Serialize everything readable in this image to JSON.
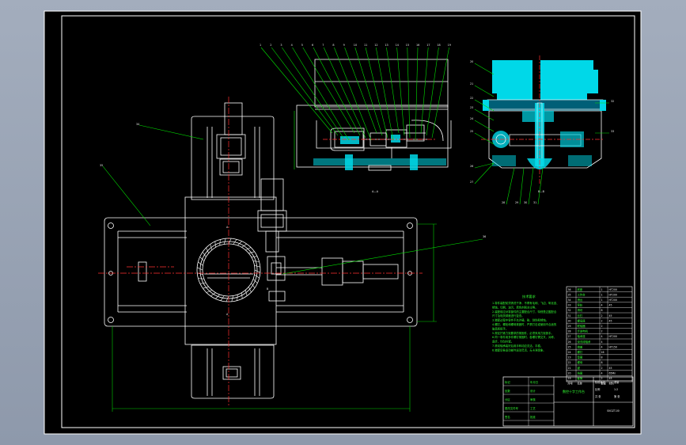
{
  "viewport": {
    "background": "#9aa5b6"
  },
  "sheet": {
    "background": "#000000",
    "frame_color": "#ffffff"
  },
  "colors": {
    "outline": "#ffffff",
    "center_line": "#ff3030",
    "leader": "#00e000",
    "section": "#00d8e8",
    "section_dark": "#0088aa",
    "dimension": "#00d000",
    "note_text": "#33ff33",
    "callout": "#e8e8e8"
  },
  "views": {
    "section_a_caption": "A—A",
    "section_b_caption": "B—B",
    "main_marks": [
      "A",
      "A",
      "B"
    ],
    "section_a_callouts": [
      "1",
      "2",
      "3",
      "4",
      "5",
      "6",
      "7",
      "8",
      "9",
      "10",
      "11",
      "12",
      "13",
      "14",
      "15",
      "16",
      "17",
      "18",
      "19"
    ],
    "section_b_callouts": [
      "20",
      "21",
      "22",
      "23",
      "24",
      "25",
      "26",
      "27",
      "28",
      "29",
      "30",
      "31",
      "32",
      "33"
    ],
    "main_callouts": [
      "34",
      "35",
      "36"
    ]
  },
  "tech_notes": {
    "title": "技术要求",
    "lines": [
      "1.零件装配前须清洗干净，不得有毛刺、飞边、氧化皮、",
      "  锈蚀、切屑、油污、着色剂和灰尘等。",
      "2.装配前应对零部件的主要配合尺寸，特别是过盈配合",
      "  尺寸及相关精度进行复查。",
      "3.装配过程中零件不允许磕、碰、划伤和锈蚀。",
      "4.螺钉、螺栓和螺母紧固时，严禁打击或使用不合适的",
      "  旋具和扳手。",
      "5.规定拧紧力矩要求的紧固件，必须采用力矩扳手。",
      "6.同一零件用多件螺钉紧固时，各螺钉需交叉、对称、",
      "  逐步、均匀拧紧。",
      "7.滚动轴承装好后用手转动应灵活、平稳。",
      "8.装配后各运动部件运动灵活，无卡滞现象。"
    ]
  },
  "parts_list": {
    "rows": [
      [
        "36",
        "底座",
        "1",
        "HT200"
      ],
      [
        "35",
        "工作台",
        "1",
        "HT200"
      ],
      [
        "34",
        "滑台",
        "1",
        "HT200"
      ],
      [
        "33",
        "导轨",
        "4",
        "45"
      ],
      [
        "32",
        "滑块",
        "8",
        ""
      ],
      [
        "31",
        "丝杠",
        "2",
        "45"
      ],
      [
        "30",
        "螺母座",
        "2",
        "45"
      ],
      [
        "29",
        "联轴器",
        "2",
        ""
      ],
      [
        "28",
        "步进电机",
        "2",
        ""
      ],
      [
        "27",
        "轴承座",
        "4",
        "HT200"
      ],
      [
        "26",
        "深沟球轴承",
        "4",
        ""
      ],
      [
        "25",
        "端盖",
        "4",
        "HT150"
      ],
      [
        "24",
        "螺钉",
        "16",
        ""
      ],
      [
        "23",
        "垫圈",
        "8",
        ""
      ],
      [
        "22",
        "螺母",
        "8",
        ""
      ],
      [
        "21",
        "键",
        "2",
        "45"
      ],
      [
        "20",
        "挡圈",
        "4",
        "65Mn"
      ],
      [
        "19",
        "套筒",
        "2",
        "45"
      ]
    ],
    "headers": [
      "序号",
      "名称",
      "数量",
      "材料"
    ]
  },
  "title_block": {
    "title": "数控十字工作台",
    "drawing_no": "SKGZT-00",
    "left_cells": [
      "标记",
      "处数",
      "分区",
      "更改文件号",
      "签名",
      "年月日",
      "设计",
      "审核",
      "工艺",
      "批准"
    ],
    "right_cells": [
      "阶段标记",
      "重量",
      "比例",
      "1:2",
      "共 张",
      "第 张"
    ]
  }
}
